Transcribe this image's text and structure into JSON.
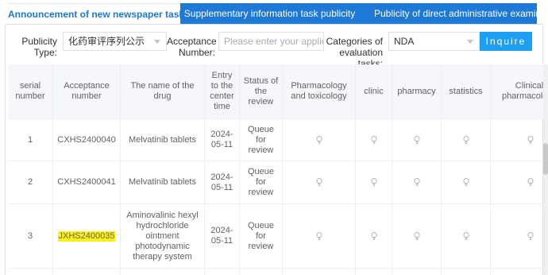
{
  "tabs": [
    {
      "label": "Announcement of new newspaper tasks"
    },
    {
      "label": "Supplementary information task publicity"
    },
    {
      "label": "Publicity of direct administrative examination"
    }
  ],
  "filters": {
    "publicity_type_label": "Publicity Type:",
    "publicity_type_value": "化药审评序列公示",
    "acceptance_number_label": "Acceptance Number:",
    "acceptance_number_placeholder": "Please enter your application",
    "categories_label": "Categories of evaluation tasks:",
    "categories_value": "NDA",
    "inquire_button": "Inquire"
  },
  "table": {
    "headers": [
      "serial number",
      "Acceptance number",
      "The name of the drug",
      "Entry to the center time",
      "Status of the review",
      "Pharmacology and toxicology",
      "clinic",
      "pharmacy",
      "statistics",
      "Clinical pharmacology"
    ],
    "rows": [
      {
        "serial": "1",
        "acceptance": "CXHS2400040",
        "drug": "Melvatinib tablets",
        "entry": "2024-05-11",
        "status": "Queue for review",
        "highlight": false
      },
      {
        "serial": "2",
        "acceptance": "CXHS2400041",
        "drug": "Melvatinib tablets",
        "entry": "2024-05-11",
        "status": "Queue for review",
        "highlight": false
      },
      {
        "serial": "3",
        "acceptance": "JXHS2400035",
        "drug": "Aminovalinic hexyl hydrochloride ointment photodynamic therapy system",
        "entry": "2024-05-11",
        "status": "Queue for review",
        "highlight": true
      }
    ]
  },
  "colors": {
    "accent": "#1e78d6",
    "button": "#1e9ff2",
    "highlight": "#fff212",
    "bulb": "#b5b5b5"
  }
}
